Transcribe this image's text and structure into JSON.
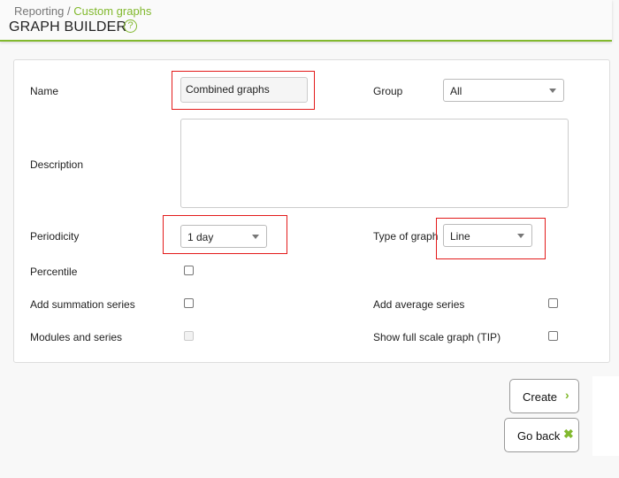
{
  "breadcrumb": {
    "parent": "Reporting",
    "separator": "/",
    "current": "Custom graphs"
  },
  "header": {
    "title": "GRAPH BUILDER",
    "help_icon": "?"
  },
  "form": {
    "name_label": "Name",
    "name_value": "Combined graphs",
    "group_label": "Group",
    "group_value": "All",
    "description_label": "Description",
    "description_value": "",
    "periodicity_label": "Periodicity",
    "periodicity_value": "1 day",
    "type_label": "Type of graph",
    "type_value": "Line",
    "percentile_label": "Percentile",
    "summation_label": "Add summation series",
    "average_label": "Add average series",
    "modules_label": "Modules and series",
    "fullscale_label": "Show full scale graph (TIP)"
  },
  "buttons": {
    "create": "Create",
    "create_icon": "›",
    "go_back": "Go back",
    "go_back_icon": "✖"
  },
  "colors": {
    "accent": "#82b92e",
    "highlight": "#e31b1b"
  }
}
